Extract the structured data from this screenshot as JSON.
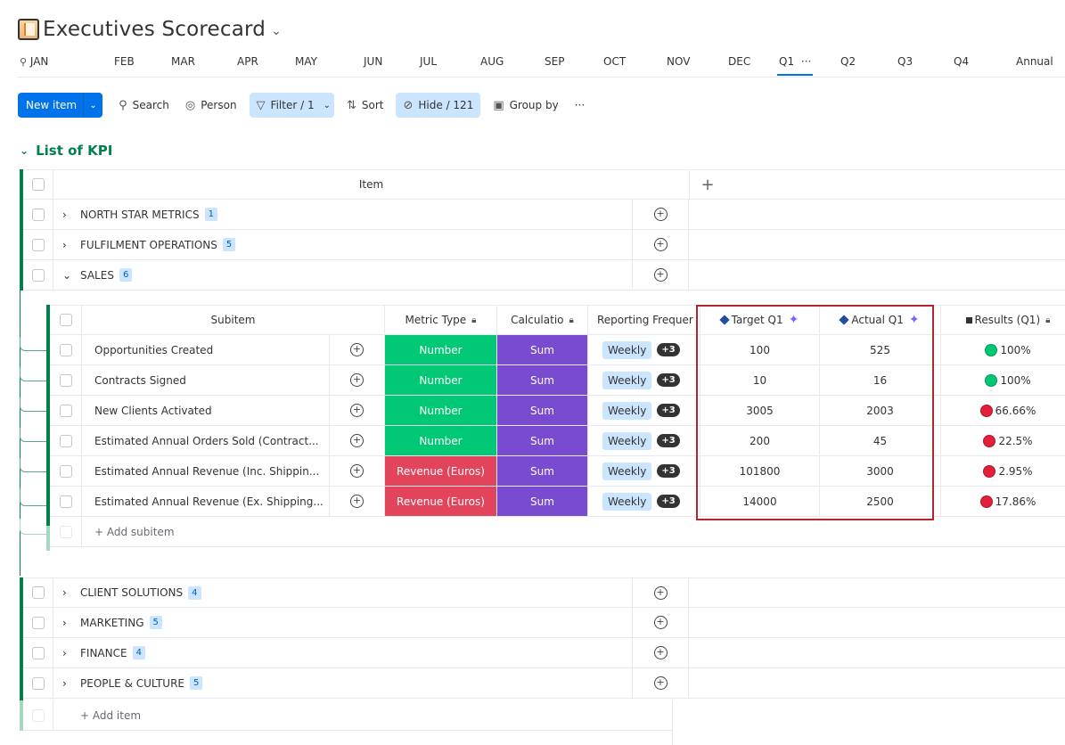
{
  "header": {
    "title": "Executives Scorecard"
  },
  "tabs": [
    "JAN",
    "FEB",
    "MAR",
    "APR",
    "MAY",
    "JUN",
    "JUL",
    "AUG",
    "SEP",
    "OCT",
    "NOV",
    "DEC",
    "Q1",
    "Q2",
    "Q3",
    "Q4",
    "Annual"
  ],
  "tab_more": "···",
  "toolbar": {
    "new_item": "New item",
    "search": "Search",
    "person": "Person",
    "filter": "Filter / 1",
    "sort": "Sort",
    "hide": "Hide / 121",
    "group_by": "Group by",
    "more": "···"
  },
  "group": {
    "title": "List of KPI"
  },
  "table": {
    "item_header": "Item",
    "groups": [
      {
        "name": "NORTH STAR METRICS",
        "count": "1",
        "expanded": false
      },
      {
        "name": "FULFILMENT OPERATIONS",
        "count": "5",
        "expanded": false
      },
      {
        "name": "SALES",
        "count": "6",
        "expanded": true
      },
      {
        "name": "CLIENT SOLUTIONS",
        "count": "4",
        "expanded": false
      },
      {
        "name": "MARKETING",
        "count": "5",
        "expanded": false
      },
      {
        "name": "FINANCE",
        "count": "4",
        "expanded": false
      },
      {
        "name": "PEOPLE & CULTURE",
        "count": "5",
        "expanded": false
      }
    ],
    "add_item": "+ Add item"
  },
  "subtable": {
    "headers": {
      "subitem": "Subitem",
      "metric": "Metric Type",
      "calc": "Calculatio",
      "rep": "Reporting Frequer",
      "target": "Target Q1",
      "actual": "Actual Q1",
      "result": "Results (Q1)"
    },
    "rows": [
      {
        "name": "Opportunities Created",
        "metric": "Number",
        "calc": "Sum",
        "rep": "Weekly",
        "more": "+3",
        "target": "100",
        "actual": "525",
        "result": "100%",
        "status": "green"
      },
      {
        "name": "Contracts Signed",
        "metric": "Number",
        "calc": "Sum",
        "rep": "Weekly",
        "more": "+3",
        "target": "10",
        "actual": "16",
        "result": "100%",
        "status": "green"
      },
      {
        "name": "New Clients Activated",
        "metric": "Number",
        "calc": "Sum",
        "rep": "Weekly",
        "more": "+3",
        "target": "3005",
        "actual": "2003",
        "result": "66.66%",
        "status": "red"
      },
      {
        "name": "Estimated Annual Orders Sold (Contract...",
        "metric": "Number",
        "calc": "Sum",
        "rep": "Weekly",
        "more": "+3",
        "target": "200",
        "actual": "45",
        "result": "22.5%",
        "status": "red"
      },
      {
        "name": "Estimated Annual Revenue (Inc. Shippin...",
        "metric": "Revenue (Euros)",
        "calc": "Sum",
        "rep": "Weekly",
        "more": "+3",
        "target": "101800",
        "actual": "3000",
        "result": "2.95%",
        "status": "red"
      },
      {
        "name": "Estimated Annual Revenue (Ex. Shipping...",
        "metric": "Revenue (Euros)",
        "calc": "Sum",
        "rep": "Weekly",
        "more": "+3",
        "target": "14000",
        "actual": "2500",
        "result": "17.86%",
        "status": "red"
      }
    ],
    "add_subitem": "+ Add subitem"
  },
  "colors": {
    "number": "#00c875",
    "revenue": "#e2445c",
    "sum": "#784bd1",
    "green": "#00c875",
    "red": "#e2203a",
    "accent": "#0073ea"
  }
}
